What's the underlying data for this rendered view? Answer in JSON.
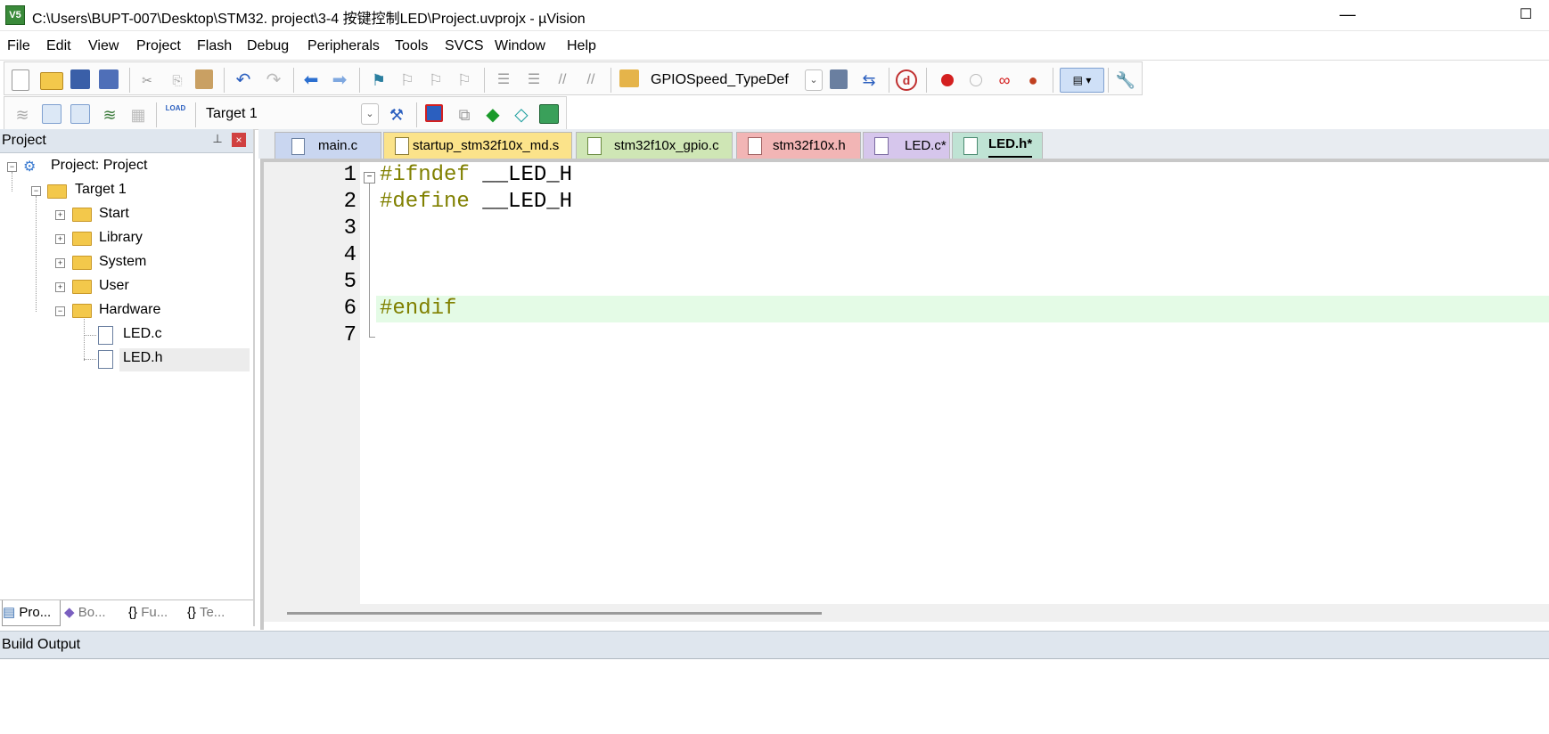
{
  "window": {
    "title": "C:\\Users\\BUPT-007\\Desktop\\STM32. project\\3-4 按键控制LED\\Project.uvprojx - µVision",
    "app_icon_text": "V5",
    "minimize_glyph": "—",
    "maximize_glyph": "☐"
  },
  "menu": [
    "File",
    "Edit",
    "View",
    "Project",
    "Flash",
    "Debug",
    "Peripherals",
    "Tools",
    "SVCS",
    "Window",
    "Help"
  ],
  "toolbar": {
    "find_combo_value": "GPIOSpeed_TypeDef",
    "target_combo_value": "Target 1",
    "load_icon_text": "LOAD"
  },
  "project_panel": {
    "title": "Project",
    "pin_glyph": "📌",
    "close_glyph": "×",
    "tree": {
      "root": "Project: Project",
      "target": "Target 1",
      "groups": [
        "Start",
        "Library",
        "System",
        "User",
        "Hardware"
      ],
      "hardware_files": [
        "LED.c",
        "LED.h"
      ]
    },
    "bottom_tabs": [
      "Pro...",
      "Bo...",
      "Fu...",
      "Te..."
    ],
    "bottom_tab_icons": [
      "▤",
      "◆",
      "{}",
      "{}"
    ]
  },
  "editor_tabs": [
    {
      "label": "main.c",
      "color": "#c9d6f0"
    },
    {
      "label": "startup_stm32f10x_md.s",
      "color": "#fbe38a"
    },
    {
      "label": "stm32f10x_gpio.c",
      "color": "#cfe6b5"
    },
    {
      "label": "stm32f10x.h",
      "color": "#f2b5b5"
    },
    {
      "label": "LED.c*",
      "color": "#d6c6ec"
    },
    {
      "label": "LED.h*",
      "color": "#bfe3d4",
      "active": true
    }
  ],
  "editor": {
    "line_numbers": [
      "1",
      "2",
      "3",
      "4",
      "5",
      "6",
      "7"
    ],
    "lines": [
      {
        "directive": "#ifndef",
        "ident": "__LED_H"
      },
      {
        "directive": "#define",
        "ident": "__LED_H"
      },
      {
        "directive": "",
        "ident": ""
      },
      {
        "directive": "",
        "ident": ""
      },
      {
        "directive": "",
        "ident": ""
      },
      {
        "directive": "#endif",
        "ident": ""
      },
      {
        "directive": "",
        "ident": ""
      }
    ],
    "fold_glyph": "−",
    "directive_color": "#808000",
    "highlight_color": "#e4fbe6"
  },
  "build_output": {
    "label": "Build Output"
  }
}
